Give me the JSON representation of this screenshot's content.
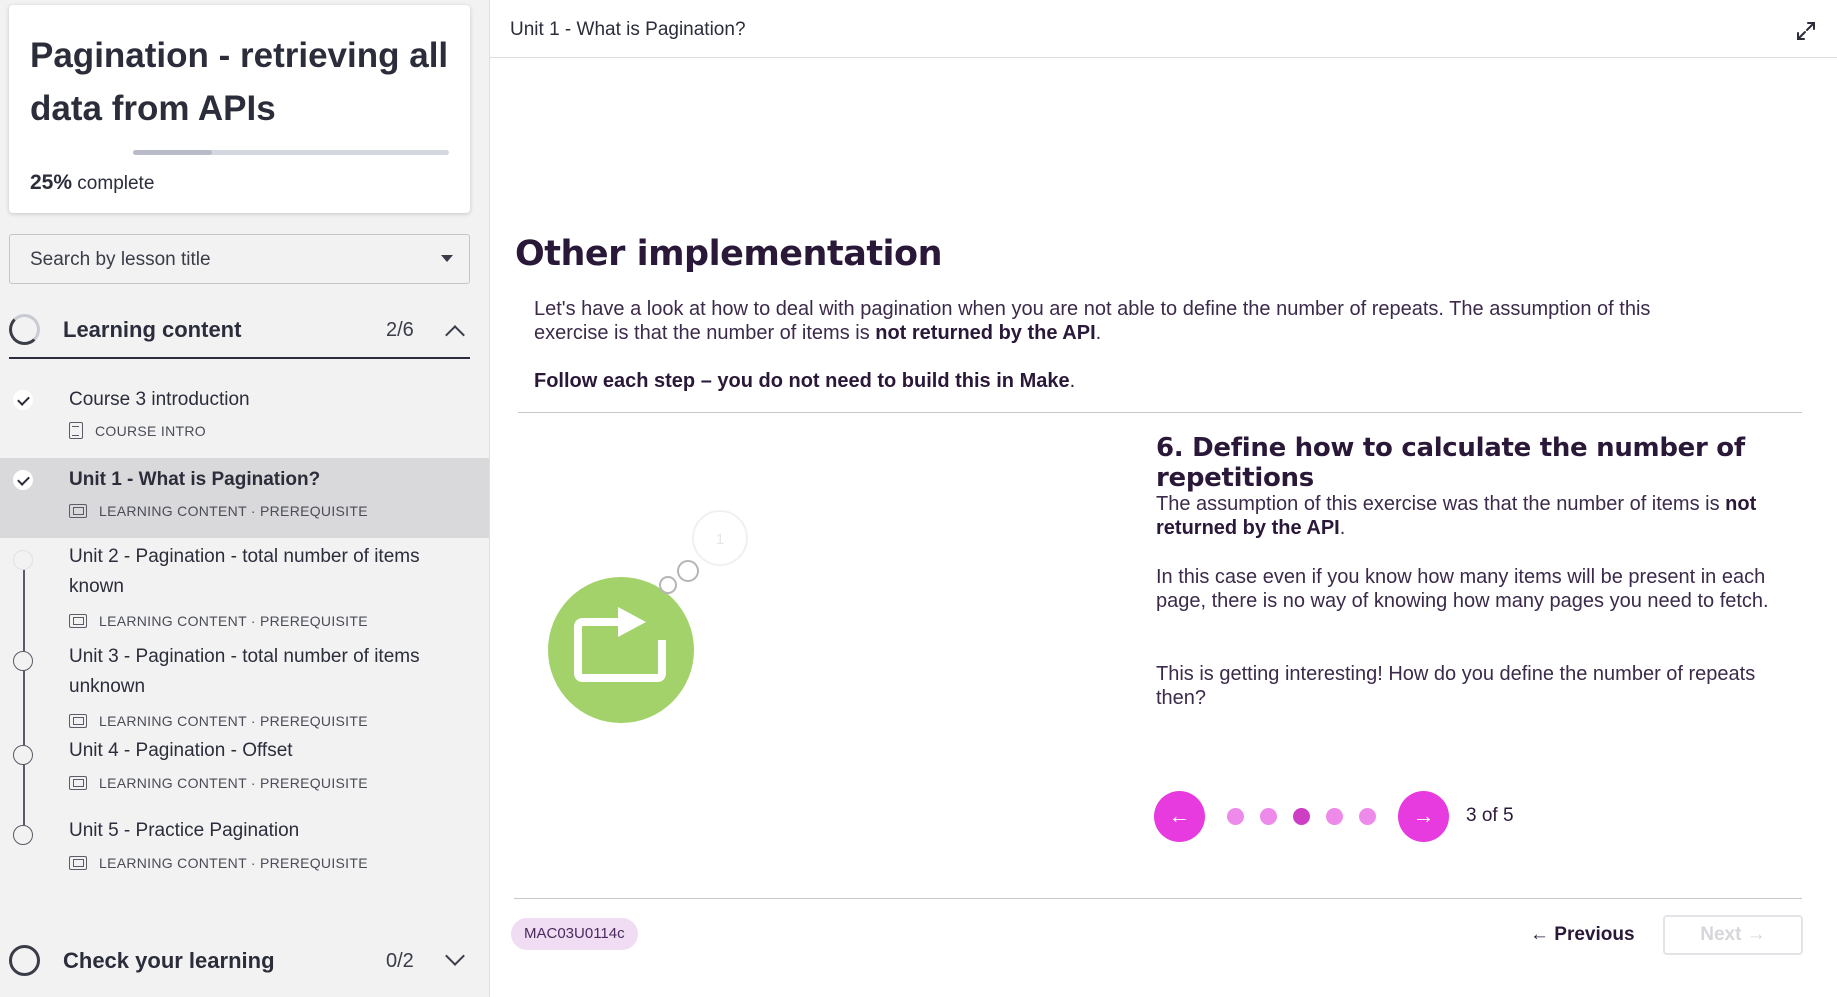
{
  "course": {
    "title": "Pagination - retrieving all data from APIs",
    "progress_percent": "25%",
    "progress_suffix": " complete",
    "progress_fraction": 0.25
  },
  "search": {
    "placeholder": "Search by lesson title",
    "icon": "chevron-down-icon"
  },
  "sections": {
    "learning": {
      "title": "Learning content",
      "count": "2/6",
      "expanded": true
    },
    "check": {
      "title": "Check your learning",
      "count": "0/2",
      "expanded": false
    }
  },
  "lessons": [
    {
      "title": "Course 3 introduction",
      "meta": "COURSE INTRO",
      "status": "done",
      "icon": "document-icon"
    },
    {
      "title": "Unit 1 - What is Pagination?",
      "meta": "LEARNING CONTENT · PREREQUISITE",
      "status": "done",
      "active": true,
      "icon": "slides-icon"
    },
    {
      "title": "Unit 2 - Pagination - total number of items known",
      "meta": "LEARNING CONTENT · PREREQUISITE",
      "status": "in-progress",
      "icon": "slides-icon"
    },
    {
      "title": "Unit 3 - Pagination - total number of items unknown",
      "meta": "LEARNING CONTENT · PREREQUISITE",
      "status": "not-started",
      "icon": "slides-icon"
    },
    {
      "title": "Unit 4 - Pagination - Offset",
      "meta": "LEARNING CONTENT · PREREQUISITE",
      "status": "not-started",
      "icon": "slides-icon"
    },
    {
      "title": "Unit 5 - Practice Pagination",
      "meta": "LEARNING CONTENT · PREREQUISITE",
      "status": "not-started",
      "icon": "slides-icon"
    }
  ],
  "header": {
    "unit_title": "Unit 1 - What is Pagination?",
    "expand_icon": "expand-icon"
  },
  "slide": {
    "title": "Other implementation",
    "intro_plain": "Let's have a look at how to deal with pagination when you are not able to define the number of repeats. The assumption of this exercise is that the number of items is ",
    "intro_bold": "not returned by the API",
    "intro_end": ".",
    "follow_bold": "Follow each step – you do not need to build this in Make",
    "follow_end": ".",
    "module_badge": "1",
    "step_title": "6. Define how to calculate the number of repetitions",
    "p1_plain": "The assumption of this exercise was that the number of items is ",
    "p1_bold": "not returned by the API",
    "p1_end": ".",
    "p2": "In this case even if you know how many items will be present in each page, there is no way of knowing how many pages you need to fetch.",
    "p3": "This is getting interesting! How do you define the number of repeats then?"
  },
  "carousel": {
    "current": 3,
    "total": 5,
    "label": "3 of 5",
    "prev_icon": "arrow-left-icon",
    "next_icon": "arrow-right-icon",
    "accent": "#e73be0"
  },
  "footer": {
    "code": "MAC03U0114c",
    "previous_label": "Previous",
    "next_label": "Next",
    "next_enabled": false
  },
  "colors": {
    "accent": "#e73be0",
    "repeater_green": "#a3d16a",
    "heading": "#2a1838"
  }
}
